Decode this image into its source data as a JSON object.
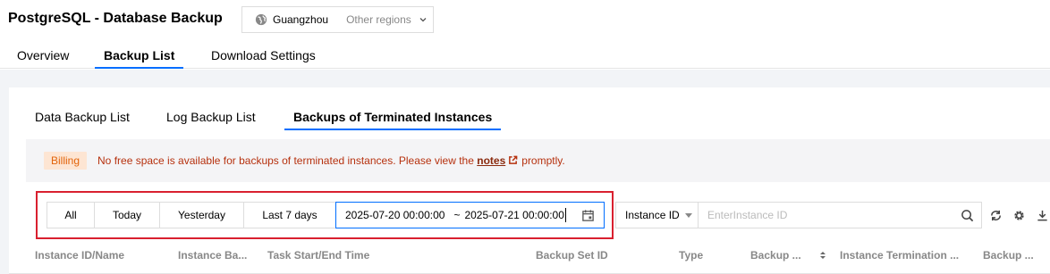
{
  "app": {
    "title": "PostgreSQL - Database Backup"
  },
  "region": {
    "name": "Guangzhou",
    "other_label": "Other regions"
  },
  "top_tabs": [
    {
      "label": "Overview"
    },
    {
      "label": "Backup List"
    },
    {
      "label": "Download Settings"
    }
  ],
  "sub_tabs": [
    {
      "label": "Data Backup List"
    },
    {
      "label": "Log Backup List"
    },
    {
      "label": "Backups of Terminated Instances"
    }
  ],
  "notice": {
    "badge": "Billing",
    "text_before": "No free space is available for backups of terminated instances. Please view the",
    "link": "notes",
    "text_after": "promptly."
  },
  "date_filter": {
    "options": [
      {
        "label": "All"
      },
      {
        "label": "Today"
      },
      {
        "label": "Yesterday"
      },
      {
        "label": "Last 7 days"
      }
    ],
    "start": "2025-07-20 00:00:00",
    "separator": "~",
    "end": "2025-07-21 00:00:00"
  },
  "search": {
    "field": "Instance ID",
    "placeholder": "EnterInstance ID"
  },
  "table": {
    "columns": [
      {
        "label": "Instance ID/Name"
      },
      {
        "label": "Instance Ba..."
      },
      {
        "label": "Task Start/End Time"
      },
      {
        "label": "Backup Set ID"
      },
      {
        "label": "Type"
      },
      {
        "label": "Backup ..."
      },
      {
        "label": "Instance Termination ..."
      },
      {
        "label": "Backup ..."
      }
    ]
  },
  "colors": {
    "accent": "#006eff",
    "highlight_border": "#d9202f",
    "notice_text": "#b6310e",
    "badge_bg": "#fde5d3"
  },
  "icons": [
    "globe-icon",
    "chevron-down-icon",
    "external-link-icon",
    "calendar-icon",
    "search-icon",
    "refresh-icon",
    "gear-icon",
    "download-icon",
    "sort-icon"
  ]
}
